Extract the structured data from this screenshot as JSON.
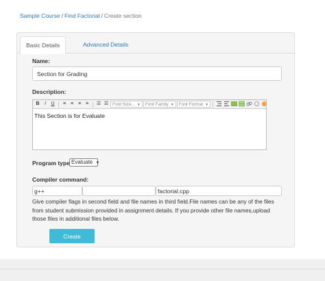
{
  "breadcrumb": {
    "course": "Sample Course",
    "assignment": "Find Factorial",
    "current": "Create section",
    "separator": "/"
  },
  "tabs": [
    {
      "label": "Basic Details",
      "active": true
    },
    {
      "label": "Advanced Details",
      "active": false
    }
  ],
  "form": {
    "name_label": "Name:",
    "name_value": "Section for Grading",
    "description_label": "Description:",
    "description_text": "This Section is for Evaluate",
    "editor_toolbar": {
      "buttons": [
        "B",
        "I",
        "U",
        "≡",
        "≡",
        "≡",
        "≡",
        "☰",
        "☰",
        "☷"
      ],
      "font_size": "Font Size...",
      "font_family": "Font Family",
      "font_format": "Font Format",
      "icons": [
        "outdent-icon",
        "indent-icon",
        "image-icon",
        "table-icon",
        "link-icon",
        "unlink-icon",
        "help-icon",
        "preview-icon"
      ]
    },
    "program_type_label": "Program type:",
    "program_type_value": "Evaluate",
    "compiler_label": "Compiler command:",
    "compiler_value": "g++",
    "flags_value": "",
    "files_value": "factorial.cpp",
    "help_text": "Give compiler flags in second field and file names in third field.File names can be any of the files from student submission provided in assignment details. If you provide other file names,upload those files in additional files below.",
    "create_label": "Create"
  },
  "colors": {
    "link": "#2a7ab8",
    "button": "#3fbbd8",
    "panel": "#f5f5f5"
  }
}
